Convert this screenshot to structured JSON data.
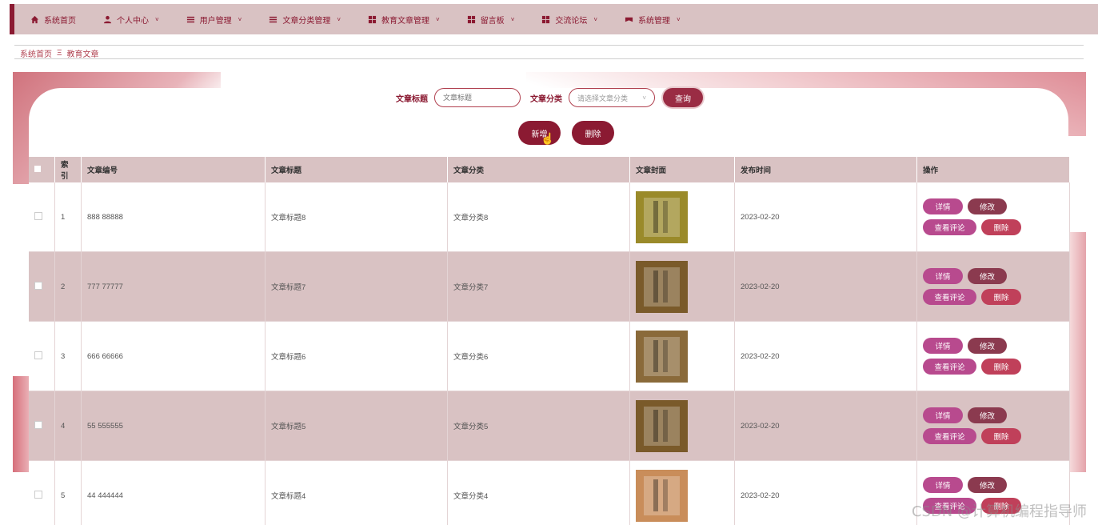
{
  "nav": {
    "items": [
      {
        "label": "系统首页",
        "icon": "home-icon",
        "dropdown": false
      },
      {
        "label": "个人中心",
        "icon": "user-icon",
        "dropdown": true
      },
      {
        "label": "用户管理",
        "icon": "list-icon",
        "dropdown": true
      },
      {
        "label": "文章分类管理",
        "icon": "list-icon",
        "dropdown": true
      },
      {
        "label": "教育文章管理",
        "icon": "grid-icon",
        "dropdown": true
      },
      {
        "label": "留言板",
        "icon": "grid-icon",
        "dropdown": true
      },
      {
        "label": "交流论坛",
        "icon": "grid-icon",
        "dropdown": true
      },
      {
        "label": "系统管理",
        "icon": "settings-icon",
        "dropdown": true
      }
    ]
  },
  "breadcrumb": {
    "home": "系统首页",
    "sep": "Ξ",
    "current": "教育文章"
  },
  "search": {
    "title_label": "文章标题",
    "title_placeholder": "文章标题",
    "category_label": "文章分类",
    "category_placeholder": "请选择文章分类",
    "query_button": "查询"
  },
  "actions": {
    "add": "新增",
    "delete": "删除"
  },
  "table": {
    "headers": [
      "",
      "索引",
      "文章编号",
      "文章标题",
      "文章分类",
      "文章封面",
      "发布时间",
      "操作"
    ],
    "rows": [
      {
        "index": "1",
        "code": "888 88888",
        "title": "文章标题8",
        "category": "文章分类8",
        "date": "2023-02-20",
        "cover_color": "#9a8a2a"
      },
      {
        "index": "2",
        "code": "777 77777",
        "title": "文章标题7",
        "category": "文章分类7",
        "date": "2023-02-20",
        "cover_color": "#7a5a2a"
      },
      {
        "index": "3",
        "code": "666 66666",
        "title": "文章标题6",
        "category": "文章分类6",
        "date": "2023-02-20",
        "cover_color": "#8a6a3a"
      },
      {
        "index": "4",
        "code": "55 555555",
        "title": "文章标题5",
        "category": "文章分类5",
        "date": "2023-02-20",
        "cover_color": "#7a5a2a"
      },
      {
        "index": "5",
        "code": "44 444444",
        "title": "文章标题4",
        "category": "文章分类4",
        "date": "2023-02-20",
        "cover_color": "#c98d5a"
      }
    ],
    "op_labels": {
      "detail": "详情",
      "edit": "修改",
      "comment": "查看评论",
      "delete": "删除"
    }
  },
  "watermark": "CSDN @计算机编程指导师",
  "colors": {
    "accent": "#8b1a32",
    "header_bg": "#d9c2c3",
    "pink": "#b84a8e"
  }
}
